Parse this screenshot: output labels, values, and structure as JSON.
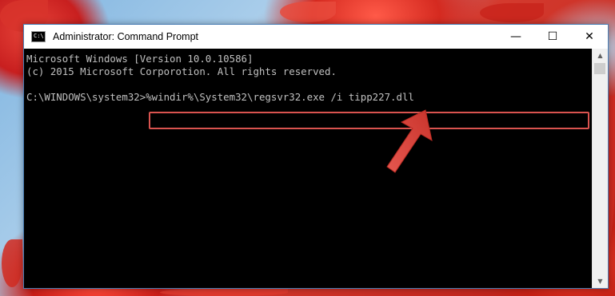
{
  "window": {
    "title": "Administrator: Command Prompt",
    "icon": "command-prompt-icon",
    "icon_text": "C:\\",
    "controls": {
      "minimize": "—",
      "maximize": "☐",
      "close": "✕"
    }
  },
  "console": {
    "lines": [
      "Microsoft Windows [Version 10.0.10586]",
      "(c) 2015 Microsoft Corporotion. All rights reserved.",
      "",
      "C:\\WINDOWS\\system32>%windir%\\System32\\regsvr32.exe /i tipp227.dll"
    ],
    "prompt": "C:\\WINDOWS\\system32>",
    "command": "%windir%\\System32\\regsvr32.exe /i tipp227.dll"
  },
  "colors": {
    "console_bg": "#000000",
    "console_text": "#c0c0c0",
    "highlight": "#d9534f",
    "arrow": "#e05a52"
  }
}
